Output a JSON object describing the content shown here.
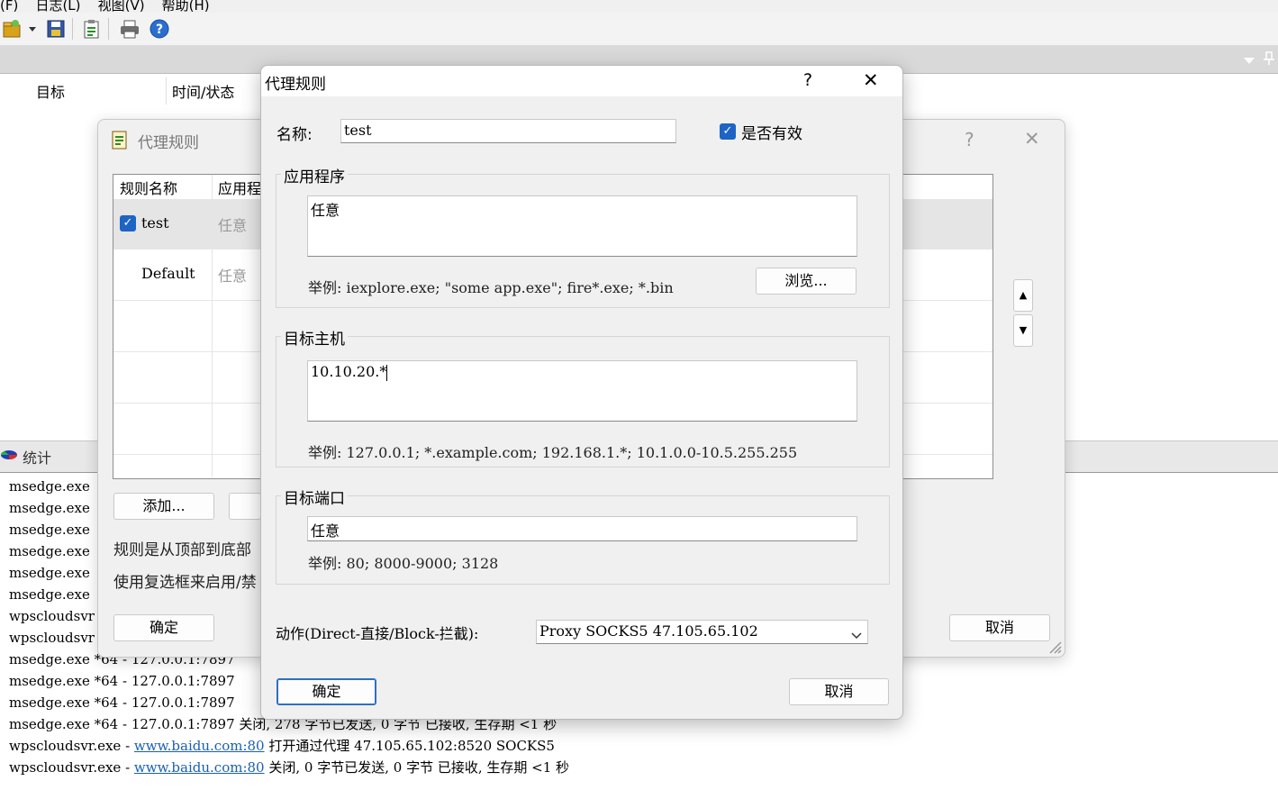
{
  "menu": {
    "items": [
      "(F)",
      "日志(L)",
      "视图(V)",
      "帮助(H)"
    ]
  },
  "main": {
    "columns": [
      "目标",
      "时间/状态"
    ],
    "stats_label": "统计",
    "log": [
      {
        "prefix": "msedge.exe",
        "link": "",
        "rest": ""
      },
      {
        "prefix": "msedge.exe",
        "link": "",
        "rest": ""
      },
      {
        "prefix": "msedge.exe",
        "link": "",
        "rest": ""
      },
      {
        "prefix": "msedge.exe",
        "link": "",
        "rest": ""
      },
      {
        "prefix": "msedge.exe",
        "link": "",
        "rest": ""
      },
      {
        "prefix": "msedge.exe",
        "link": "",
        "rest": ""
      },
      {
        "prefix": "wpscloudsvr",
        "link": "",
        "rest": ""
      },
      {
        "prefix": "wpscloudsvr",
        "link": "",
        "rest": ""
      },
      {
        "prefix": "msedge.exe *64 - 127.0.0.1:7897",
        "link": "",
        "rest": ""
      },
      {
        "prefix": "msedge.exe *64 - 127.0.0.1:7897",
        "link": "",
        "rest": ""
      },
      {
        "prefix": "msedge.exe *64 - 127.0.0.1:7897",
        "link": "",
        "rest": ""
      },
      {
        "prefix": "msedge.exe *64 - 127.0.0.1:7897 关闭, 278 字节已发送, 0 字节 已接收, 生存期 <1 秒",
        "link": "",
        "rest": ""
      },
      {
        "prefix": "wpscloudsvr.exe - ",
        "link": "www.baidu.com:80",
        "rest": " 打开通过代理 47.105.65.102:8520 SOCKS5"
      },
      {
        "prefix": "wpscloudsvr.exe - ",
        "link": "www.baidu.com:80",
        "rest": " 关闭, 0 字节已发送, 0 字节 已接收, 生存期 <1 秒"
      }
    ]
  },
  "bg_dialog": {
    "title": "代理规则",
    "help": "?",
    "close": "✕",
    "columns": [
      "规则名称",
      "应用程"
    ],
    "rows": [
      {
        "name": "test",
        "app": "任意",
        "checked": true
      },
      {
        "name": "Default",
        "app": "任意",
        "checked": false
      }
    ],
    "add_button": "添加...",
    "note1": "规则是从顶部到底部",
    "note2": "使用复选框来启用/禁",
    "ok": "确定",
    "cancel": "取消",
    "up": "▲",
    "down": "▼"
  },
  "dialog": {
    "title": "代理规则",
    "help": "?",
    "close": "✕",
    "name_label": "名称:",
    "name_value": "test",
    "enabled_label": "是否有效",
    "app_group": "应用程序",
    "app_value": "任意",
    "app_hint": "举例: iexplore.exe; \"some app.exe\"; fire*.exe; *.bin",
    "browse": "浏览...",
    "host_group": "目标主机",
    "host_value": "10.10.20.*",
    "host_hint": "举例: 127.0.0.1; *.example.com; 192.168.1.*; 10.1.0.0-10.5.255.255",
    "port_group": "目标端口",
    "port_value": "任意",
    "port_hint": "举例: 80; 8000-9000; 3128",
    "action_label": "动作(Direct-直接/Block-拦截):",
    "action_value": "Proxy SOCKS5 47.105.65.102",
    "ok": "确定",
    "cancel": "取消"
  }
}
